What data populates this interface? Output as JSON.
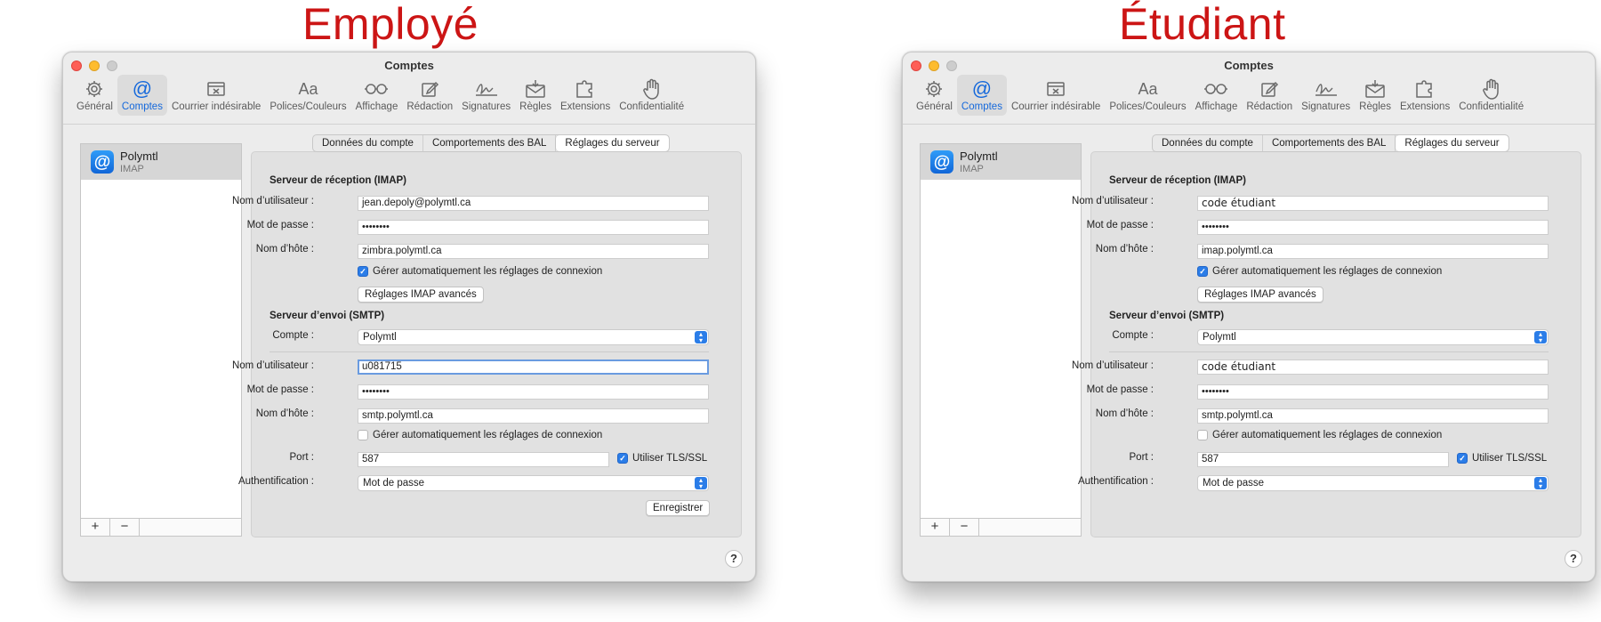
{
  "titles": {
    "left": "Employé",
    "right": "Étudiant"
  },
  "window": {
    "title": "Comptes",
    "toolbar": [
      {
        "label": "Général",
        "icon": "gear-icon"
      },
      {
        "label": "Comptes",
        "icon": "at-icon"
      },
      {
        "label": "Courrier indésirable",
        "icon": "junk-tray-icon"
      },
      {
        "label": "Polices/Couleurs",
        "icon": "fonts-icon"
      },
      {
        "label": "Affichage",
        "icon": "glasses-icon"
      },
      {
        "label": "Rédaction",
        "icon": "compose-icon"
      },
      {
        "label": "Signatures",
        "icon": "signature-icon"
      },
      {
        "label": "Règles",
        "icon": "rules-envelope-icon"
      },
      {
        "label": "Extensions",
        "icon": "puzzle-icon"
      },
      {
        "label": "Confidentialité",
        "icon": "hand-icon"
      }
    ],
    "account": {
      "name": "Polymtl",
      "type": "IMAP"
    },
    "list_buttons": {
      "add": "+",
      "remove": "−"
    },
    "tabs": [
      "Données du compte",
      "Comportements des BAL",
      "Réglages du serveur"
    ],
    "incoming": {
      "heading": "Serveur de réception (IMAP)",
      "user_label": "Nom d’utilisateur :",
      "pass_label": "Mot de passe :",
      "host_label": "Nom d’hôte :",
      "pass_value": "••••••••",
      "auto_label": "Gérer automatiquement les réglages de connexion",
      "advanced_button": "Réglages IMAP avancés"
    },
    "outgoing": {
      "heading": "Serveur d’envoi (SMTP)",
      "account_label": "Compte :",
      "account_value": "Polymtl",
      "user_label": "Nom d’utilisateur :",
      "pass_label": "Mot de passe :",
      "host_label": "Nom d’hôte :",
      "host_value": "smtp.polymtl.ca",
      "pass_value": "••••••••",
      "auto_label": "Gérer automatiquement les réglages de connexion",
      "port_label": "Port :",
      "port_value": "587",
      "tls_label": "Utiliser TLS/SSL",
      "auth_label": "Authentification :",
      "auth_value": "Mot de passe"
    },
    "save_button": "Enregistrer",
    "help": "?"
  },
  "employee": {
    "imap_user": "jean.depoly@polymtl.ca",
    "imap_host": "zimbra.polymtl.ca",
    "smtp_user": "u081715"
  },
  "student": {
    "imap_user": "code étudiant",
    "imap_host": "imap.polymtl.ca",
    "smtp_user": "code étudiant"
  },
  "colors": {
    "title_red": "#cc1515",
    "accent_blue": "#1468db"
  }
}
